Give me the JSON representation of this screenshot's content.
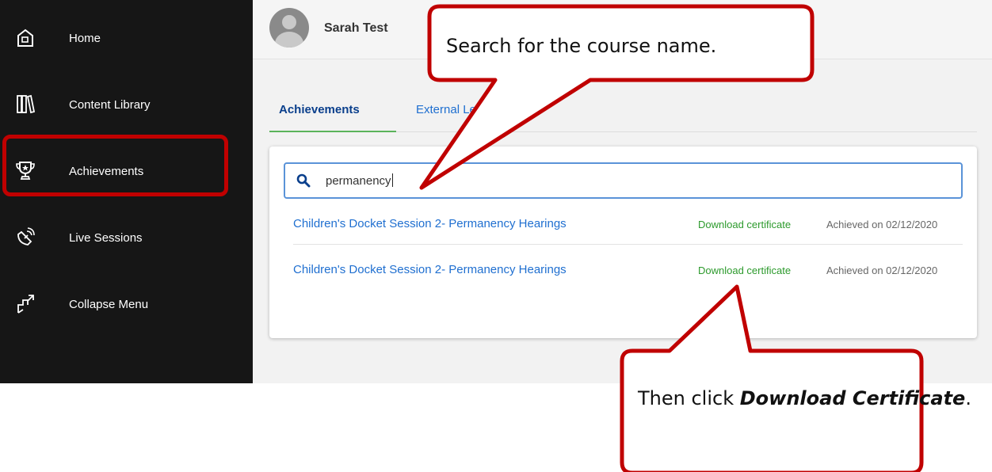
{
  "sidebar": {
    "items": [
      {
        "label": "Home",
        "icon": "home-icon"
      },
      {
        "label": "Content Library",
        "icon": "library-icon"
      },
      {
        "label": "Achievements",
        "icon": "trophy-icon"
      },
      {
        "label": "Live Sessions",
        "icon": "satellite-icon"
      },
      {
        "label": "Collapse Menu",
        "icon": "collapse-menu-icon"
      }
    ]
  },
  "header": {
    "user_name": "Sarah Test"
  },
  "tabs": [
    {
      "label": "Achievements",
      "active": true
    },
    {
      "label": "External Learning",
      "active": false
    }
  ],
  "search": {
    "value": "permanency",
    "icon": "search-icon"
  },
  "results": [
    {
      "course": "Children's Docket Session 2- Permanency Hearings",
      "download": "Download certificate",
      "achieved": "Achieved on 02/12/2020"
    },
    {
      "course": "Children's Docket Session 2- Permanency Hearings",
      "download": "Download certificate",
      "achieved": "Achieved on 02/12/2020"
    }
  ],
  "callouts": {
    "top": "Search for the course name.",
    "bottom_prefix": "Then click ",
    "bottom_emphasis": "Download Certificate",
    "bottom_suffix": "."
  },
  "colors": {
    "sidebar_bg": "#161616",
    "link_blue": "#1f6fd0",
    "download_green": "#2c9a2c",
    "annotation_red": "#c00000",
    "tab_underline": "#5bb35b"
  }
}
